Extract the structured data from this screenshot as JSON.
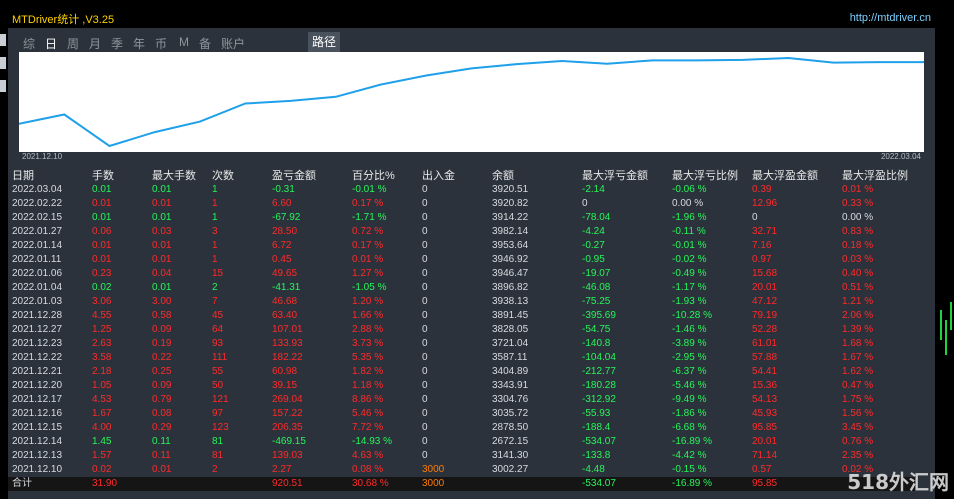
{
  "window": {
    "title": "MTDriver统计 ,V3.25",
    "url": "http://mtdriver.cn"
  },
  "tabs": [
    {
      "label": "综",
      "active": false
    },
    {
      "label": "日",
      "active": true
    },
    {
      "label": "周",
      "active": false
    },
    {
      "label": "月",
      "active": false
    },
    {
      "label": "季",
      "active": false
    },
    {
      "label": "年",
      "active": false
    },
    {
      "label": "币",
      "active": false
    },
    {
      "label": "M",
      "active": false
    },
    {
      "label": "备",
      "active": false
    },
    {
      "label": "账户",
      "active": false
    }
  ],
  "path_button": "路径",
  "chart_data": {
    "type": "line",
    "x_start_label": "2021.12.10",
    "x_end_label": "2022.03.04",
    "y": [
      3002.27,
      3141.3,
      2672.15,
      2878.5,
      3035.72,
      3304.76,
      3343.91,
      3404.89,
      3587.11,
      3721.04,
      3828.05,
      3891.45,
      3938.13,
      3896.82,
      3946.47,
      3946.92,
      3953.64,
      3982.14,
      3914.22,
      3920.82,
      3920.51
    ],
    "line_color": "#1ea0ea"
  },
  "table": {
    "headers": [
      "日期",
      "手数",
      "最大手数",
      "次数",
      "盈亏金额",
      "百分比%",
      "出入金",
      "余额",
      "最大浮亏金额",
      "最大浮亏比例",
      "最大浮盈金额",
      "最大浮盈比例"
    ],
    "rows": [
      {
        "date": "2022.03.04",
        "lots": "0.01",
        "maxlots": "0.01",
        "count": "1",
        "pnl": "-0.31",
        "pct": "-0.01 %",
        "flow": "0",
        "bal": "3920.51",
        "fl": "-2.14",
        "flp": "-0.06 %",
        "fp": "0.39",
        "fpp": "0.01 %",
        "s": "g"
      },
      {
        "date": "2022.02.22",
        "lots": "0.01",
        "maxlots": "0.01",
        "count": "1",
        "pnl": "6.60",
        "pct": "0.17 %",
        "flow": "0",
        "bal": "3920.82",
        "fl": "0",
        "flp": "0.00 %",
        "fp": "12.96",
        "fpp": "0.33 %",
        "s": "r"
      },
      {
        "date": "2022.02.15",
        "lots": "0.01",
        "maxlots": "0.01",
        "count": "1",
        "pnl": "-67.92",
        "pct": "-1.71 %",
        "flow": "0",
        "bal": "3914.22",
        "fl": "-78.04",
        "flp": "-1.96 %",
        "fp": "0",
        "fpp": "0.00 %",
        "s": "g"
      },
      {
        "date": "2022.01.27",
        "lots": "0.06",
        "maxlots": "0.03",
        "count": "3",
        "pnl": "28.50",
        "pct": "0.72 %",
        "flow": "0",
        "bal": "3982.14",
        "fl": "-4.24",
        "flp": "-0.11 %",
        "fp": "32.71",
        "fpp": "0.83 %",
        "s": "r"
      },
      {
        "date": "2022.01.14",
        "lots": "0.01",
        "maxlots": "0.01",
        "count": "1",
        "pnl": "6.72",
        "pct": "0.17 %",
        "flow": "0",
        "bal": "3953.64",
        "fl": "-0.27",
        "flp": "-0.01 %",
        "fp": "7.16",
        "fpp": "0.18 %",
        "s": "r"
      },
      {
        "date": "2022.01.11",
        "lots": "0.01",
        "maxlots": "0.01",
        "count": "1",
        "pnl": "0.45",
        "pct": "0.01 %",
        "flow": "0",
        "bal": "3946.92",
        "fl": "-0.95",
        "flp": "-0.02 %",
        "fp": "0.97",
        "fpp": "0.03 %",
        "s": "r"
      },
      {
        "date": "2022.01.06",
        "lots": "0.23",
        "maxlots": "0.04",
        "count": "15",
        "pnl": "49.65",
        "pct": "1.27 %",
        "flow": "0",
        "bal": "3946.47",
        "fl": "-19.07",
        "flp": "-0.49 %",
        "fp": "15.68",
        "fpp": "0.40 %",
        "s": "r"
      },
      {
        "date": "2022.01.04",
        "lots": "0.02",
        "maxlots": "0.01",
        "count": "2",
        "pnl": "-41.31",
        "pct": "-1.05 %",
        "flow": "0",
        "bal": "3896.82",
        "fl": "-46.08",
        "flp": "-1.17 %",
        "fp": "20.01",
        "fpp": "0.51 %",
        "s": "g"
      },
      {
        "date": "2022.01.03",
        "lots": "3.06",
        "maxlots": "3.00",
        "count": "7",
        "pnl": "46.68",
        "pct": "1.20 %",
        "flow": "0",
        "bal": "3938.13",
        "fl": "-75.25",
        "flp": "-1.93 %",
        "fp": "47.12",
        "fpp": "1.21 %",
        "s": "r"
      },
      {
        "date": "2021.12.28",
        "lots": "4.55",
        "maxlots": "0.58",
        "count": "45",
        "pnl": "63.40",
        "pct": "1.66 %",
        "flow": "0",
        "bal": "3891.45",
        "fl": "-395.69",
        "flp": "-10.28 %",
        "fp": "79.19",
        "fpp": "2.06 %",
        "s": "r"
      },
      {
        "date": "2021.12.27",
        "lots": "1.25",
        "maxlots": "0.09",
        "count": "64",
        "pnl": "107.01",
        "pct": "2.88 %",
        "flow": "0",
        "bal": "3828.05",
        "fl": "-54.75",
        "flp": "-1.46 %",
        "fp": "52.28",
        "fpp": "1.39 %",
        "s": "r"
      },
      {
        "date": "2021.12.23",
        "lots": "2.63",
        "maxlots": "0.19",
        "count": "93",
        "pnl": "133.93",
        "pct": "3.73 %",
        "flow": "0",
        "bal": "3721.04",
        "fl": "-140.8",
        "flp": "-3.89 %",
        "fp": "61.01",
        "fpp": "1.68 %",
        "s": "r"
      },
      {
        "date": "2021.12.22",
        "lots": "3.58",
        "maxlots": "0.22",
        "count": "111",
        "pnl": "182.22",
        "pct": "5.35 %",
        "flow": "0",
        "bal": "3587.11",
        "fl": "-104.04",
        "flp": "-2.95 %",
        "fp": "57.88",
        "fpp": "1.67 %",
        "s": "r"
      },
      {
        "date": "2021.12.21",
        "lots": "2.18",
        "maxlots": "0.25",
        "count": "55",
        "pnl": "60.98",
        "pct": "1.82 %",
        "flow": "0",
        "bal": "3404.89",
        "fl": "-212.77",
        "flp": "-6.37 %",
        "fp": "54.41",
        "fpp": "1.62 %",
        "s": "r"
      },
      {
        "date": "2021.12.20",
        "lots": "1.05",
        "maxlots": "0.09",
        "count": "50",
        "pnl": "39.15",
        "pct": "1.18 %",
        "flow": "0",
        "bal": "3343.91",
        "fl": "-180.28",
        "flp": "-5.46 %",
        "fp": "15.36",
        "fpp": "0.47 %",
        "s": "r"
      },
      {
        "date": "2021.12.17",
        "lots": "4.53",
        "maxlots": "0.79",
        "count": "121",
        "pnl": "269.04",
        "pct": "8.86 %",
        "flow": "0",
        "bal": "3304.76",
        "fl": "-312.92",
        "flp": "-9.49 %",
        "fp": "54.13",
        "fpp": "1.75 %",
        "s": "r"
      },
      {
        "date": "2021.12.16",
        "lots": "1.67",
        "maxlots": "0.08",
        "count": "97",
        "pnl": "157.22",
        "pct": "5.46 %",
        "flow": "0",
        "bal": "3035.72",
        "fl": "-55.93",
        "flp": "-1.86 %",
        "fp": "45.93",
        "fpp": "1.56 %",
        "s": "r"
      },
      {
        "date": "2021.12.15",
        "lots": "4.00",
        "maxlots": "0.29",
        "count": "123",
        "pnl": "206.35",
        "pct": "7.72 %",
        "flow": "0",
        "bal": "2878.50",
        "fl": "-188.4",
        "flp": "-6.68 %",
        "fp": "95.85",
        "fpp": "3.45 %",
        "s": "r"
      },
      {
        "date": "2021.12.14",
        "lots": "1.45",
        "maxlots": "0.11",
        "count": "81",
        "pnl": "-469.15",
        "pct": "-14.93 %",
        "flow": "0",
        "bal": "2672.15",
        "fl": "-534.07",
        "flp": "-16.89 %",
        "fp": "20.01",
        "fpp": "0.76 %",
        "s": "g"
      },
      {
        "date": "2021.12.13",
        "lots": "1.57",
        "maxlots": "0.11",
        "count": "81",
        "pnl": "139.03",
        "pct": "4.63 %",
        "flow": "0",
        "bal": "3141.30",
        "fl": "-133.8",
        "flp": "-4.42 %",
        "fp": "71.14",
        "fpp": "2.35 %",
        "s": "r"
      },
      {
        "date": "2021.12.10",
        "lots": "0.02",
        "maxlots": "0.01",
        "count": "2",
        "pnl": "2.27",
        "pct": "0.08 %",
        "flow": "3000",
        "bal": "3002.27",
        "fl": "-4.48",
        "flp": "-0.15 %",
        "fp": "0.57",
        "fpp": "0.02 %",
        "s": "r"
      }
    ],
    "total": {
      "label": "合计",
      "lots": "31.90",
      "pnl": "920.51",
      "pct": "30.68 %",
      "flow": "3000",
      "bal": "",
      "fl": "-534.07",
      "flp": "-16.89 %",
      "fp": "95.85"
    }
  },
  "watermark": "518外汇网"
}
